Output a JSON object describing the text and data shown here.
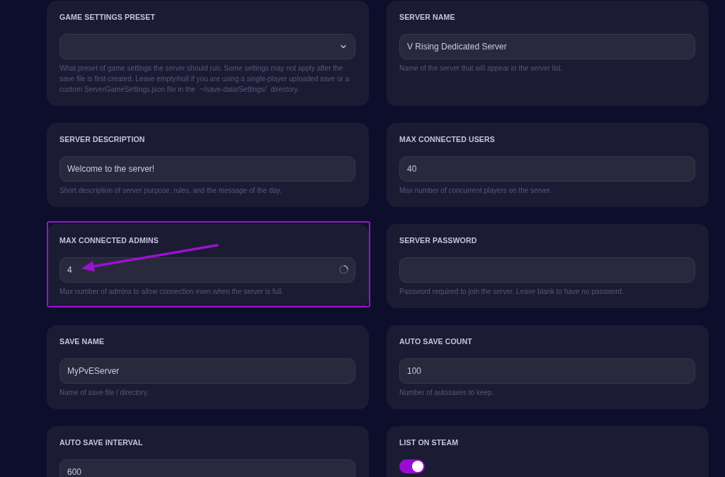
{
  "fields": [
    {
      "kind": "select",
      "label": "GAME SETTINGS PRESET",
      "help": "What preset of game settings the server should run. Some settings may not apply after the save file is first created. Leave empty/null if you are using a single-player uploaded save or a custom ServerGameSettings.json file in the `~/save-data/Settings/` directory.",
      "highlighted": false
    },
    {
      "kind": "text",
      "label": "SERVER NAME",
      "value": "V Rising Dedicated Server",
      "help": "Name of the server that will appear in the server list.",
      "loading": false,
      "highlighted": false
    },
    {
      "kind": "text",
      "label": "SERVER DESCRIPTION",
      "value": "Welcome to the server!",
      "help": "Short description of server purpose, rules, and the message of the day.",
      "loading": false,
      "highlighted": false
    },
    {
      "kind": "text",
      "label": "MAX CONNECTED USERS",
      "value": "40",
      "help": "Max number of concurrent players on the server.",
      "loading": false,
      "highlighted": false
    },
    {
      "kind": "text",
      "label": "MAX CONNECTED ADMINS",
      "value": "4",
      "help": "Max number of admins to allow connection even when the server is full.",
      "loading": true,
      "highlighted": true
    },
    {
      "kind": "text",
      "label": "SERVER PASSWORD",
      "help": "Password required to join the server. Leave blank to have no password.",
      "loading": false,
      "highlighted": false
    },
    {
      "kind": "text",
      "label": "SAVE NAME",
      "value": "MyPvEServer",
      "help": "Name of save file / directory.",
      "loading": false,
      "highlighted": false
    },
    {
      "kind": "text",
      "label": "AUTO SAVE COUNT",
      "value": "100",
      "help": "Number of autosaves to keep.",
      "loading": false,
      "highlighted": false
    },
    {
      "kind": "text",
      "label": "AUTO SAVE INTERVAL",
      "value": "600",
      "loading": false,
      "highlighted": false
    },
    {
      "kind": "toggle",
      "label": "LIST ON STEAM",
      "on": true,
      "highlighted": false
    }
  ]
}
